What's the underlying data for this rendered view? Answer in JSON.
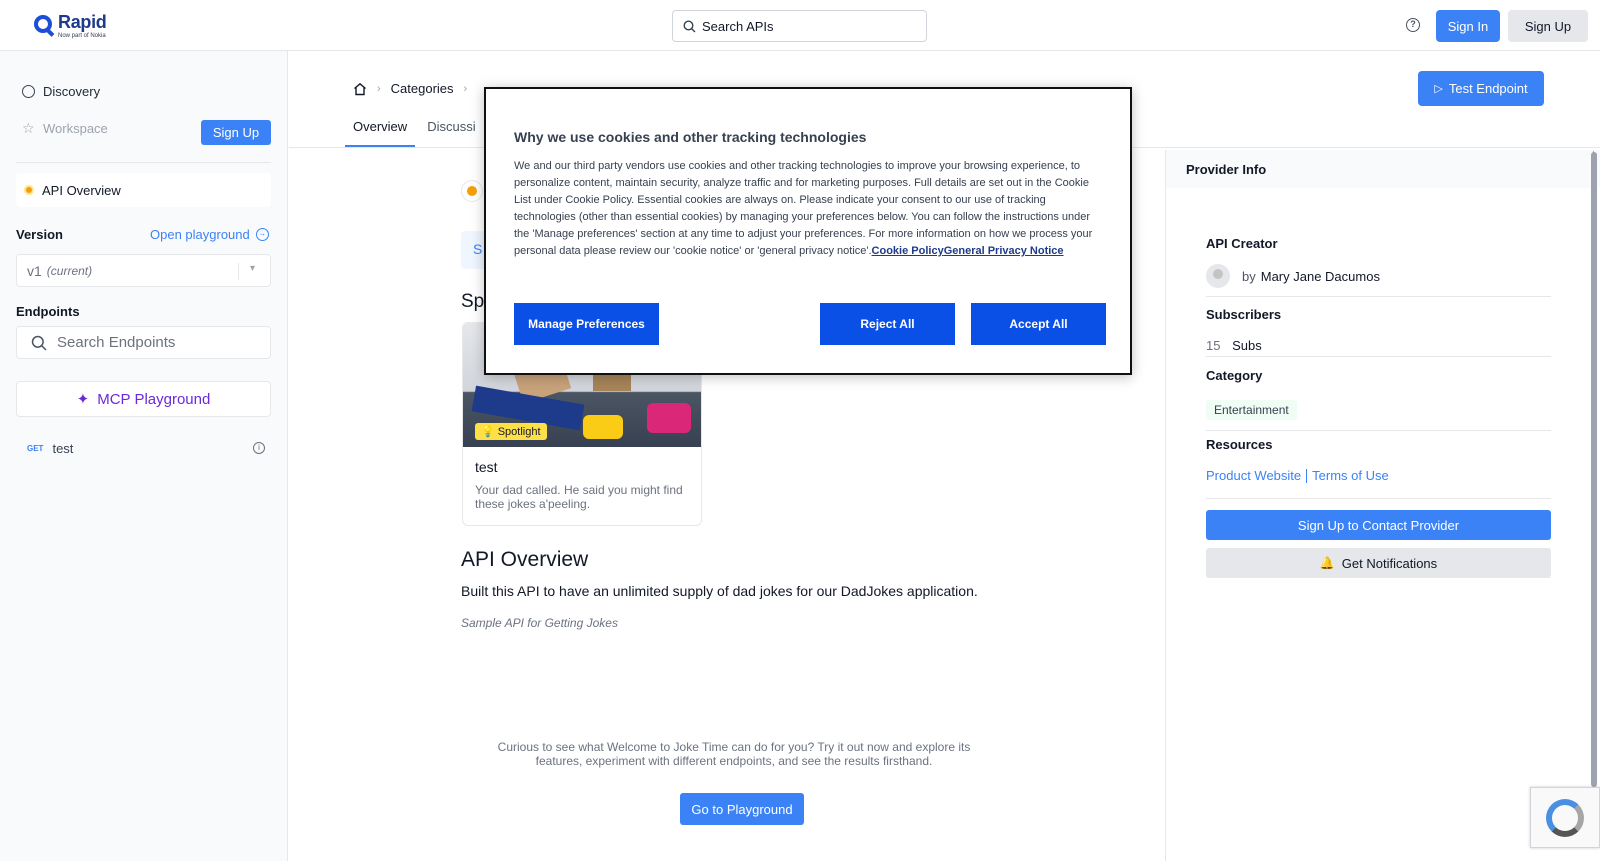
{
  "header": {
    "logo_name": "Rapid",
    "logo_sub": "Now part of Nokia",
    "search_placeholder": "Search APIs",
    "sign_in": "Sign In",
    "sign_up": "Sign Up"
  },
  "sidebar": {
    "discovery": "Discovery",
    "workspace": "Workspace",
    "sign_up": "Sign Up",
    "api_overview": "API Overview",
    "version_label": "Version",
    "open_playground": "Open playground",
    "version_value": "v1",
    "version_tag": "(current)",
    "endpoints_label": "Endpoints",
    "search_endpoints_placeholder": "Search Endpoints",
    "mcp_playground": "MCP Playground",
    "endpoints": [
      {
        "method": "GET",
        "name": "test"
      }
    ]
  },
  "main": {
    "breadcrumb": [
      "Categories"
    ],
    "tabs": [
      "Overview",
      "Discussi"
    ],
    "test_endpoint": "Test Endpoint",
    "partial_letter": "S",
    "spotlight_heading": "Sp",
    "spotlight_card": {
      "badge": "Spotlight",
      "title": "test",
      "description": "Your dad called. He said you might find these jokes a'peeling."
    },
    "overview_heading": "API Overview",
    "overview_text": "Built this API to have an unlimited supply of dad jokes for our DadJokes application.",
    "overview_italic": "Sample API for Getting Jokes",
    "curious_text": "Curious to see what Welcome to Joke Time can do for you? Try it out now and explore its features, experiment with different endpoints, and see the results firsthand.",
    "go_playground": "Go to Playground"
  },
  "provider": {
    "header": "Provider Info",
    "creator_label": "API Creator",
    "creator_by": "by",
    "creator_name": "Mary Jane Dacumos",
    "subscribers_label": "Subscribers",
    "subscribers_count": "15",
    "subscribers_unit": "Subs",
    "category_label": "Category",
    "category_value": "Entertainment",
    "resources_label": "Resources",
    "product_website": "Product Website",
    "terms_of_use": "Terms of Use",
    "contact_button": "Sign Up to Contact Provider",
    "notifications_button": "Get Notifications"
  },
  "cookie_modal": {
    "title": "Why we use cookies and other tracking technologies",
    "body": "We and our third party vendors use cookies and other tracking technologies to improve your browsing experience, to personalize content, maintain security, analyze traffic and for marketing purposes. Full details are set out in the Cookie List under Cookie Policy. Essential cookies are always on. Please indicate your consent to our use of tracking technologies (other than essential cookies) by managing your preferences below. You can follow the instructions under the 'Manage preferences' section at any time to adjust your preferences. For more information on how we process your personal data please review our 'cookie notice' or 'general privacy notice'.",
    "cookie_policy_link": "Cookie Policy",
    "privacy_link": "General Privacy Notice",
    "manage": "Manage Preferences",
    "reject": "Reject All",
    "accept": "Accept All"
  },
  "colors": {
    "accent": "#3b82f6",
    "cookie_button": "#0a4fe6",
    "mcp_purple": "#6d28d9"
  }
}
